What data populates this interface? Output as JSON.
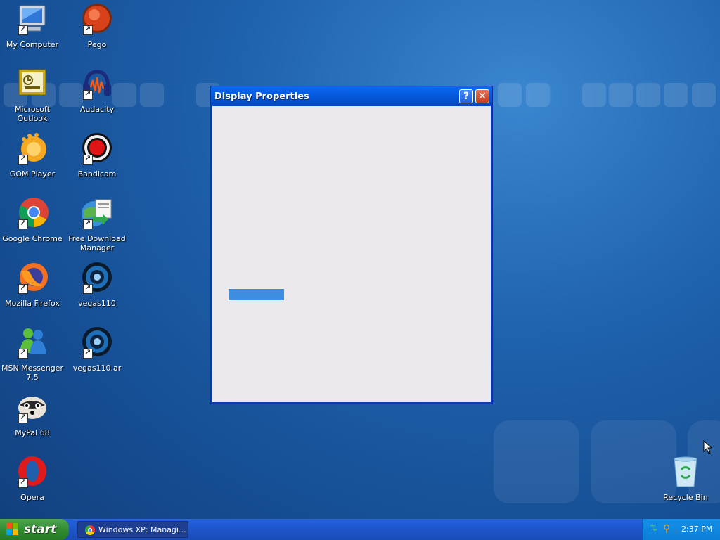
{
  "desktop": {
    "icons": [
      {
        "label": "My Computer",
        "icon": "my-computer-icon"
      },
      {
        "label": "Pego",
        "icon": "pego-icon"
      },
      {
        "label": "Microsoft Outlook",
        "icon": "outlook-icon"
      },
      {
        "label": "Audacity",
        "icon": "audacity-icon"
      },
      {
        "label": "GOM Player",
        "icon": "gom-player-icon"
      },
      {
        "label": "Bandicam",
        "icon": "bandicam-icon"
      },
      {
        "label": "Google Chrome",
        "icon": "chrome-icon"
      },
      {
        "label": "Free Download Manager",
        "icon": "free-download-manager-icon"
      },
      {
        "label": "Mozilla Firefox",
        "icon": "firefox-icon"
      },
      {
        "label": "vegas110",
        "icon": "vegas-icon"
      },
      {
        "label": "MSN Messenger 7.5",
        "icon": "msn-messenger-icon"
      },
      {
        "label": "vegas110.ar",
        "icon": "vegas-icon"
      },
      {
        "label": "MyPal 68",
        "icon": "mypal-icon"
      },
      {
        "label": "Opera",
        "icon": "opera-icon"
      },
      {
        "label": "Recycle Bin",
        "icon": "recycle-bin-icon"
      }
    ]
  },
  "dialog": {
    "title": "Display Properties",
    "help_glyph": "?",
    "close_glyph": "✕",
    "progress_fraction": 0.45,
    "progress_color": "#3c8ee0"
  },
  "taskbar": {
    "start_label": "start",
    "tasks": [
      {
        "label": "Windows XP: Managi...",
        "icon": "chrome-icon"
      }
    ],
    "tray": {
      "icons": [
        "network-icon",
        "search-icon"
      ],
      "clock": "2:37 PM"
    }
  },
  "colors": {
    "desktop_blue": "#1f62ad",
    "titlebar_blue": "#0559db",
    "start_green": "#2f8a2f"
  }
}
